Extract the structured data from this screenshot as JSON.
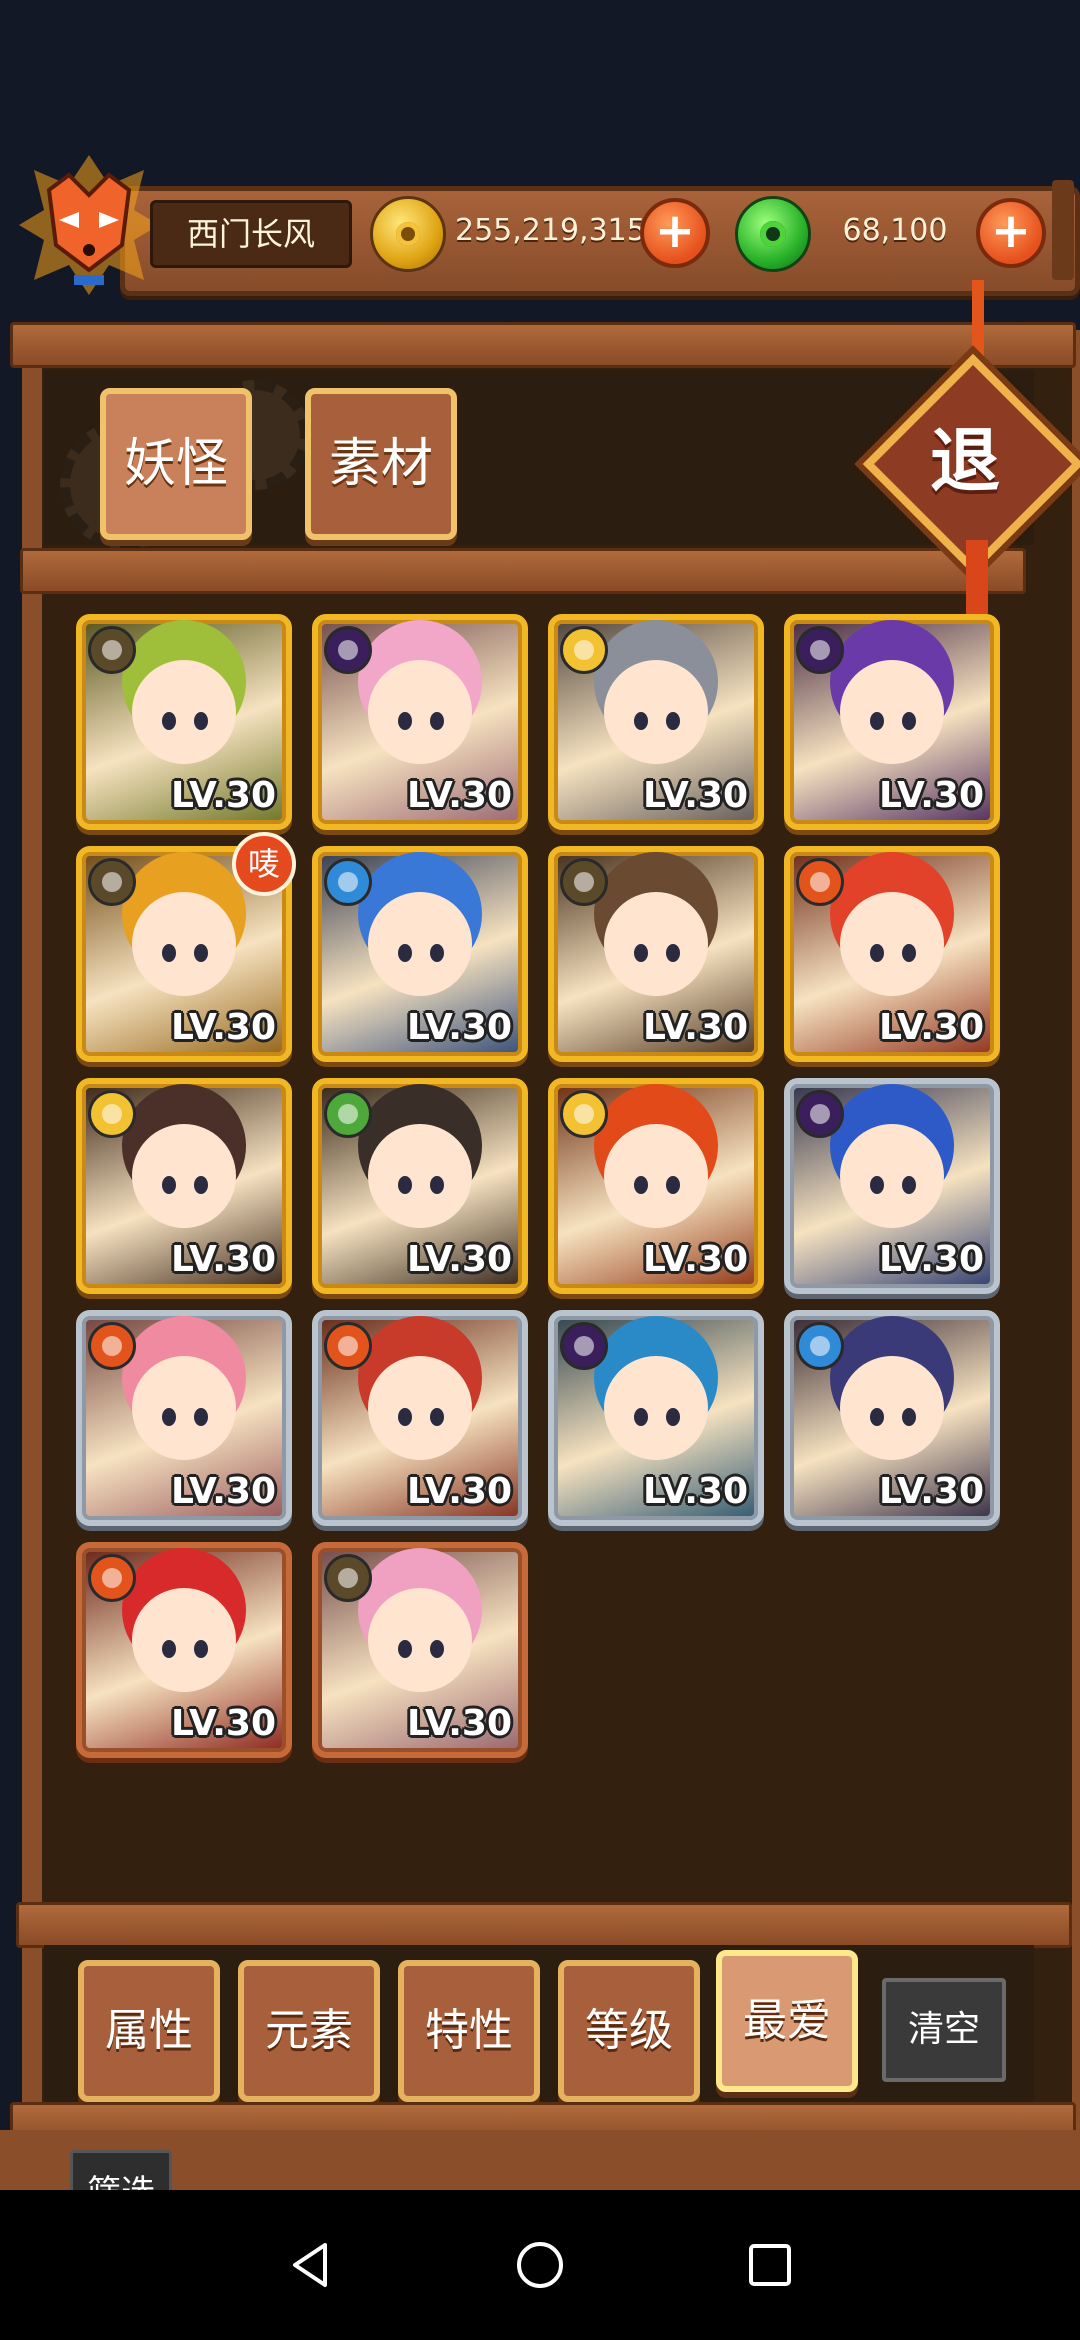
{
  "header": {
    "player_name": "西门长风",
    "coins": "255,219,315",
    "jade": "68,100",
    "plus_symbol": "+"
  },
  "tabs": [
    {
      "label": "妖怪",
      "active": true
    },
    {
      "label": "素材",
      "active": false
    }
  ],
  "exit_label": "退",
  "heroes": [
    {
      "level": "LV.30",
      "element": "earth",
      "frame": "gold",
      "hair": "#9fbf3a"
    },
    {
      "level": "LV.30",
      "element": "dark",
      "frame": "gold",
      "hair": "#f2a6c8"
    },
    {
      "level": "LV.30",
      "element": "light",
      "frame": "gold",
      "hair": "#8a8f99"
    },
    {
      "level": "LV.30",
      "element": "dark",
      "frame": "gold",
      "hair": "#6a3aa8"
    },
    {
      "level": "LV.30",
      "element": "earth",
      "frame": "gold",
      "hair": "#e8a020",
      "badge": "唛"
    },
    {
      "level": "LV.30",
      "element": "water",
      "frame": "gold",
      "hair": "#3a78d8"
    },
    {
      "level": "LV.30",
      "element": "earth",
      "frame": "gold",
      "hair": "#6a4a30"
    },
    {
      "level": "LV.30",
      "element": "fire",
      "frame": "gold",
      "hair": "#e2412a"
    },
    {
      "level": "LV.30",
      "element": "light",
      "frame": "gold",
      "hair": "#4a3028"
    },
    {
      "level": "LV.30",
      "element": "wood",
      "frame": "gold",
      "hair": "#3a2e28"
    },
    {
      "level": "LV.30",
      "element": "light",
      "frame": "gold",
      "hair": "#e24a1a"
    },
    {
      "level": "LV.30",
      "element": "dark",
      "frame": "silver",
      "hair": "#2e5ac8"
    },
    {
      "level": "LV.30",
      "element": "fire",
      "frame": "silver",
      "hair": "#f08aa0"
    },
    {
      "level": "LV.30",
      "element": "fire",
      "frame": "silver",
      "hair": "#c83a2a"
    },
    {
      "level": "LV.30",
      "element": "dark",
      "frame": "silver",
      "hair": "#2a8ac8"
    },
    {
      "level": "LV.30",
      "element": "water",
      "frame": "silver",
      "hair": "#3a3a78"
    },
    {
      "level": "LV.30",
      "element": "fire",
      "frame": "bronze",
      "hair": "#d82a2a"
    },
    {
      "level": "LV.30",
      "element": "earth",
      "frame": "bronze",
      "hair": "#f0a0c0"
    }
  ],
  "element_colors": {
    "earth": "#5b4a2a",
    "dark": "#3a1f5c",
    "light": "#f2c233",
    "water": "#2f8ad8",
    "fire": "#e2541c",
    "wood": "#4fa83a"
  },
  "filters": [
    {
      "label": "属性",
      "active": false
    },
    {
      "label": "元素",
      "active": false
    },
    {
      "label": "特性",
      "active": false
    },
    {
      "label": "等级",
      "active": false
    },
    {
      "label": "最爱",
      "active": true
    }
  ],
  "clear_label": "清空",
  "screen_label": "筛选"
}
